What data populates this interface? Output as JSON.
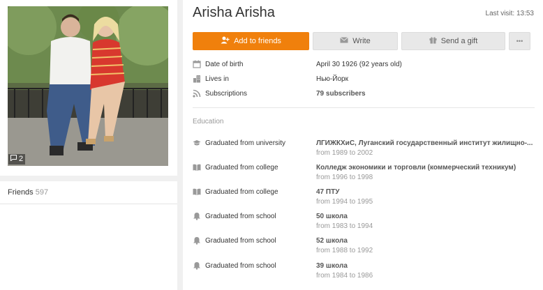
{
  "photo": {
    "count": "2"
  },
  "friends": {
    "label": "Friends",
    "count": "597"
  },
  "profile": {
    "name": "Arisha Arisha",
    "last_visit": "Last visit: 13:53"
  },
  "actions": {
    "add_friends": "Add to friends",
    "write": "Write",
    "gift": "Send a gift",
    "more": "•••"
  },
  "info": [
    {
      "label": "Date of birth",
      "value": "April 30 1926 (92 years old)"
    },
    {
      "label": "Lives in",
      "value": "Нью-Йорк"
    },
    {
      "label": "Subscriptions",
      "value": "79 subscribers"
    }
  ],
  "education": {
    "title": "Education",
    "items": [
      {
        "type": "Graduated from university",
        "name": "ЛГИЖКХиС, Луганский государственный институт жилищно-...",
        "years": "from 1989 to 2002"
      },
      {
        "type": "Graduated from college",
        "name": "Колледж экономики и торговли (коммерческий техникум)",
        "years": "from 1996 to 1998"
      },
      {
        "type": "Graduated from college",
        "name": "47 ПТУ",
        "years": "from 1994 to 1995"
      },
      {
        "type": "Graduated from school",
        "name": "50 школа",
        "years": "from 1983 to 1994"
      },
      {
        "type": "Graduated from school",
        "name": "52 школа",
        "years": "from 1988 to 1992"
      },
      {
        "type": "Graduated from school",
        "name": "39 школа",
        "years": "from 1984 to 1986"
      }
    ]
  }
}
